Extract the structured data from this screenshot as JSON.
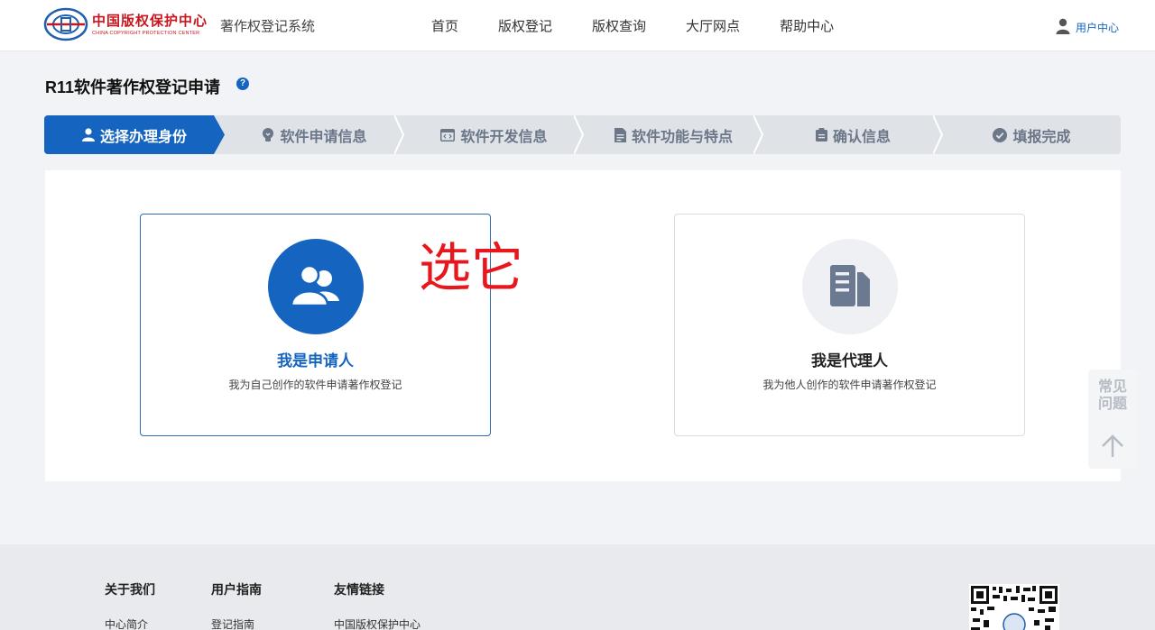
{
  "header": {
    "logo_cn": "中国版权保护中心",
    "logo_en": "CHINA COPYRIGHT PROTECTION CENTER",
    "system_title": "著作权登记系统",
    "nav": [
      "首页",
      "版权登记",
      "版权查询",
      "大厅网点",
      "帮助中心"
    ],
    "user_label": "用户中心"
  },
  "page": {
    "title": "R11软件著作权登记申请",
    "help_icon": "question-circle-icon"
  },
  "steps": [
    {
      "label": "选择办理身份",
      "icon": "user-icon",
      "active": true
    },
    {
      "label": "软件申请信息",
      "icon": "lightbulb-icon",
      "active": false
    },
    {
      "label": "软件开发信息",
      "icon": "code-window-icon",
      "active": false
    },
    {
      "label": "软件功能与特点",
      "icon": "document-icon",
      "active": false
    },
    {
      "label": "确认信息",
      "icon": "clipboard-icon",
      "active": false
    },
    {
      "label": "填报完成",
      "icon": "check-circle-icon",
      "active": false
    }
  ],
  "roles": [
    {
      "title": "我是申请人",
      "desc": "我为自己创作的软件申请著作权登记",
      "icon": "users-icon",
      "selected": true
    },
    {
      "title": "我是代理人",
      "desc": "我为他人创作的软件申请著作权登记",
      "icon": "documents-icon",
      "selected": false
    }
  ],
  "annotation": "选它",
  "float_panel": {
    "label": "常见问题",
    "up_icon": "arrow-up-icon"
  },
  "footer": {
    "columns": [
      {
        "heading": "关于我们",
        "links": [
          "中心简介"
        ]
      },
      {
        "heading": "用户指南",
        "links": [
          "登记指南"
        ]
      },
      {
        "heading": "友情链接",
        "links": [
          "中国版权保护中心"
        ]
      }
    ],
    "qr_icon": "qr-code-icon"
  },
  "colors": {
    "primary": "#1565c0",
    "annotation": "#e8161d",
    "brand_red": "#c8161e"
  }
}
